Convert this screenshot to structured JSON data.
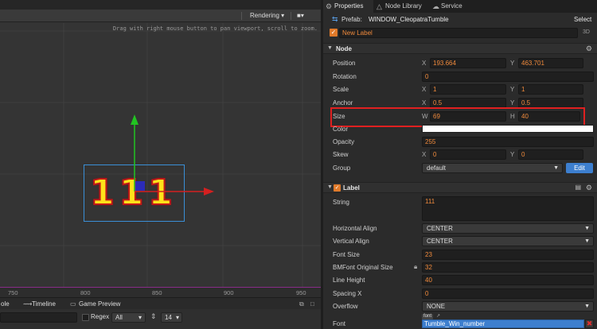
{
  "scene": {
    "toolbar": {
      "render_mode": "Rendering",
      "camera_dropdown": "▾"
    },
    "hint": "Drag with right mouse button to pan viewport, scroll to zoom.",
    "ruler_ticks": [
      "750",
      "800",
      "850",
      "900",
      "950"
    ],
    "label_text": "111",
    "bottom_tabs": {
      "console_tab": "ole",
      "timeline_tab": "Timeline",
      "preview_tab": "Game Preview"
    },
    "filter": {
      "regex_label": "Regex",
      "level_select": "All",
      "font_size_select": "14"
    }
  },
  "properties": {
    "tabs": {
      "properties": "Properties",
      "node_library": "Node Library",
      "service": "Service"
    },
    "prefab": {
      "label": "Prefab:",
      "name": "WINDOW_CleopatraTumble",
      "select_button": "Select"
    },
    "node_name": "New Label",
    "badge_3d": "3D",
    "node_section": {
      "title": "Node",
      "position": {
        "label": "Position",
        "x_axis": "X",
        "x": "193.664",
        "y_axis": "Y",
        "y": "463.701"
      },
      "rotation": {
        "label": "Rotation",
        "value": "0"
      },
      "scale": {
        "label": "Scale",
        "x_axis": "X",
        "x": "1",
        "y_axis": "Y",
        "y": "1"
      },
      "anchor": {
        "label": "Anchor",
        "x_axis": "X",
        "x": "0.5",
        "y_axis": "Y",
        "y": "0.5"
      },
      "size": {
        "label": "Size",
        "w_axis": "W",
        "w": "69",
        "h_axis": "H",
        "h": "40"
      },
      "color": {
        "label": "Color",
        "value": "#ffffff"
      },
      "opacity": {
        "label": "Opacity",
        "value": "255"
      },
      "skew": {
        "label": "Skew",
        "x_axis": "X",
        "x": "0",
        "y_axis": "Y",
        "y": "0"
      },
      "group": {
        "label": "Group",
        "value": "default",
        "edit_button": "Edit"
      }
    },
    "label_section": {
      "title": "Label",
      "string": {
        "label": "String",
        "value": "111"
      },
      "horizontal_align": {
        "label": "Horizontal Align",
        "value": "CENTER"
      },
      "vertical_align": {
        "label": "Vertical Align",
        "value": "CENTER"
      },
      "font_size": {
        "label": "Font Size",
        "value": "23"
      },
      "bmfont_original_size": {
        "label": "BMFont Original Size",
        "value": "32"
      },
      "line_height": {
        "label": "Line Height",
        "value": "40"
      },
      "spacing_x": {
        "label": "Spacing X",
        "value": "0"
      },
      "overflow": {
        "label": "Overflow",
        "value": "NONE"
      },
      "font": {
        "label": "Font",
        "tag": "font",
        "value": "Tumble_Win_number"
      }
    }
  },
  "colors": {
    "accent_orange": "#f08a3c",
    "edit_blue": "#3d7fcf",
    "highlight_red": "#e02020",
    "gizmo_green": "#22c322",
    "gizmo_red": "#d42020"
  }
}
